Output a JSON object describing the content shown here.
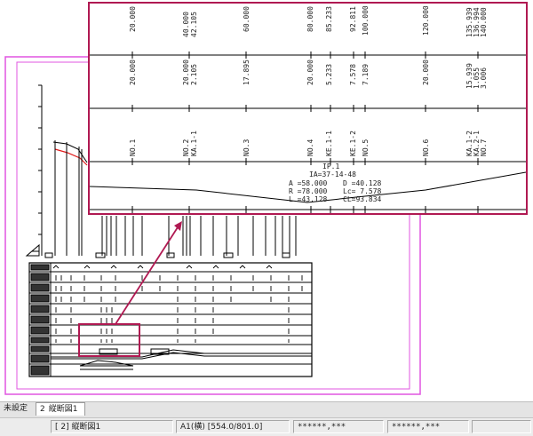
{
  "profile": {
    "stations": [
      "20.000",
      "40.000",
      "42.105",
      "60.000",
      "80.000",
      "85.233",
      "92.811",
      "100.000",
      "120.000",
      "135.939",
      "136.994",
      "140.000"
    ],
    "distances": [
      "20.000",
      "20.000",
      "2.105",
      "17.895",
      "20.000",
      "5.233",
      "7.578",
      "7.189",
      "20.000",
      "15.939",
      "1.055",
      "3.006"
    ],
    "points": [
      "NO.1",
      "NO.2",
      "KA.1-1",
      "NO.3",
      "NO.4",
      "KE.1-1",
      "KE.1-2",
      "NO.5",
      "NO.6",
      "KA.1-2",
      "KA.2-1",
      "NO.7"
    ],
    "ip": {
      "title": "IP.1",
      "ia": "IA=37-14-48",
      "a": "A =58.000",
      "d": "D =40.128",
      "r": "R =78.000",
      "lc": "Lc= 7.578",
      "l": "L =43.128",
      "cl": "CL=93.834"
    }
  },
  "tabs": {
    "default_label": "未設定",
    "active_number": "2",
    "active_label": "縦断図1"
  },
  "status": {
    "view": "[ 2] 縦断図1",
    "paper": "A1(横) [554.0/801.0]",
    "coord1": "******,***",
    "coord2": "******,***",
    "extra": ""
  },
  "colors": {
    "callout_border": "#b01952",
    "sheet_frame": "#e055e0",
    "profile_red": "#e01b1b"
  }
}
